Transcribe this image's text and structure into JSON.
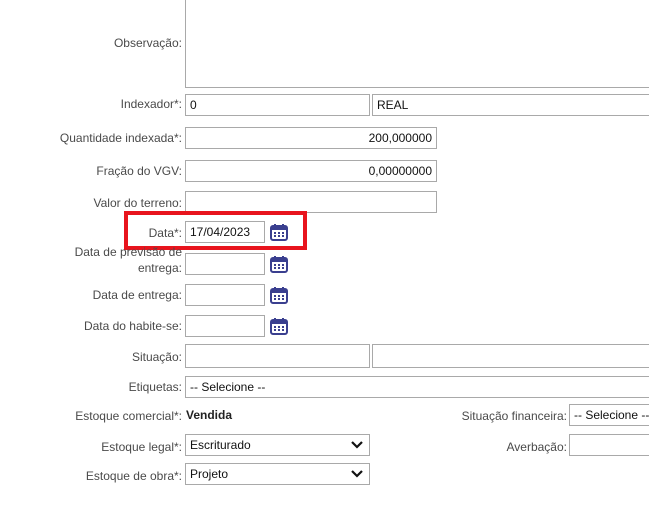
{
  "form": {
    "observacao_label": "Observação:",
    "observacao_value": "",
    "indexador_label": "Indexador*:",
    "indexador_code": "0",
    "indexador_name": "REAL",
    "quantidade_label": "Quantidade indexada*:",
    "quantidade_value": "200,000000",
    "fracao_label": "Fração do VGV:",
    "fracao_value": "0,00000000",
    "terreno_label": "Valor do terreno:",
    "terreno_value": "",
    "data_label": "Data*:",
    "data_value": "17/04/2023",
    "previsao_label_1": "Data de previsão de",
    "previsao_label_2": "entrega:",
    "previsao_value": "",
    "entrega_label": "Data de entrega:",
    "entrega_value": "",
    "habite_label": "Data do habite-se:",
    "habite_value": "",
    "situacao_label": "Situação:",
    "situacao_code": "",
    "situacao_desc": "",
    "etiquetas_label": "Etiquetas:",
    "etiquetas_value": "-- Selecione --",
    "estoque_comercial_label": "Estoque comercial*:",
    "estoque_comercial_value": "Vendida",
    "situacao_financeira_label": "Situação financeira:",
    "situacao_financeira_value": "-- Selecione --",
    "estoque_legal_label": "Estoque legal*:",
    "estoque_legal_value": "Escriturado",
    "averbacao_label": "Averbação:",
    "averbacao_value": "",
    "estoque_obra_label": "Estoque de obra*:",
    "estoque_obra_value": "Projeto"
  },
  "icons": {
    "calendar": "calendar-icon",
    "dropdown": "chevron-down-icon"
  },
  "colors": {
    "highlight": "#e8141d",
    "calendar": "#3a3f8f",
    "border": "#a9a9a9"
  }
}
